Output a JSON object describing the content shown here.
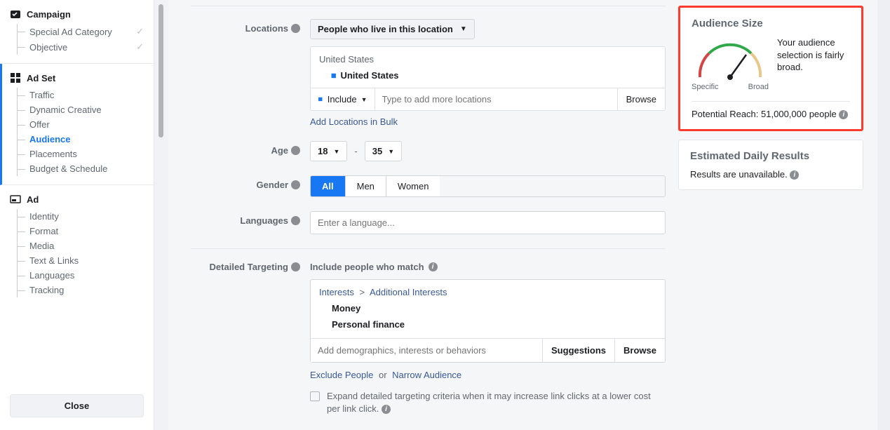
{
  "sidebar": {
    "campaign": {
      "title": "Campaign",
      "items": [
        {
          "label": "Special Ad Category",
          "checked": true
        },
        {
          "label": "Objective",
          "checked": true
        }
      ]
    },
    "adset": {
      "title": "Ad Set",
      "items": [
        {
          "label": "Traffic"
        },
        {
          "label": "Dynamic Creative"
        },
        {
          "label": "Offer"
        },
        {
          "label": "Audience",
          "active": true
        },
        {
          "label": "Placements"
        },
        {
          "label": "Budget & Schedule"
        }
      ]
    },
    "ad": {
      "title": "Ad",
      "items": [
        {
          "label": "Identity"
        },
        {
          "label": "Format"
        },
        {
          "label": "Media"
        },
        {
          "label": "Text & Links"
        },
        {
          "label": "Languages"
        },
        {
          "label": "Tracking"
        }
      ]
    },
    "close_label": "Close"
  },
  "form": {
    "locations": {
      "label": "Locations",
      "mode_label": "People who live in this location",
      "group_header": "United States",
      "items": [
        "United States"
      ],
      "include_label": "Include",
      "input_placeholder": "Type to add more locations",
      "browse_label": "Browse",
      "bulk_link": "Add Locations in Bulk"
    },
    "age": {
      "label": "Age",
      "min": "18",
      "max": "35",
      "dash": "-"
    },
    "gender": {
      "label": "Gender",
      "options": [
        "All",
        "Men",
        "Women"
      ],
      "active": "All"
    },
    "languages": {
      "label": "Languages",
      "placeholder": "Enter a language..."
    },
    "detailed": {
      "label": "Detailed Targeting",
      "sublabel": "Include people who match",
      "breadcrumb": [
        "Interests",
        "Additional Interests"
      ],
      "items": [
        "Money",
        "Personal finance"
      ],
      "input_placeholder": "Add demographics, interests or behaviors",
      "suggestions_label": "Suggestions",
      "browse_label": "Browse",
      "exclude_label": "Exclude People",
      "or_text": "or",
      "narrow_label": "Narrow Audience",
      "expand_text": "Expand detailed targeting criteria when it may increase link clicks at a lower cost per link click."
    }
  },
  "audience_panel": {
    "title": "Audience Size",
    "gauge_min": "Specific",
    "gauge_max": "Broad",
    "message": "Your audience selection is fairly broad.",
    "reach_label": "Potential Reach:",
    "reach_value": "51,000,000 people"
  },
  "results_panel": {
    "title": "Estimated Daily Results",
    "message": "Results are unavailable."
  }
}
